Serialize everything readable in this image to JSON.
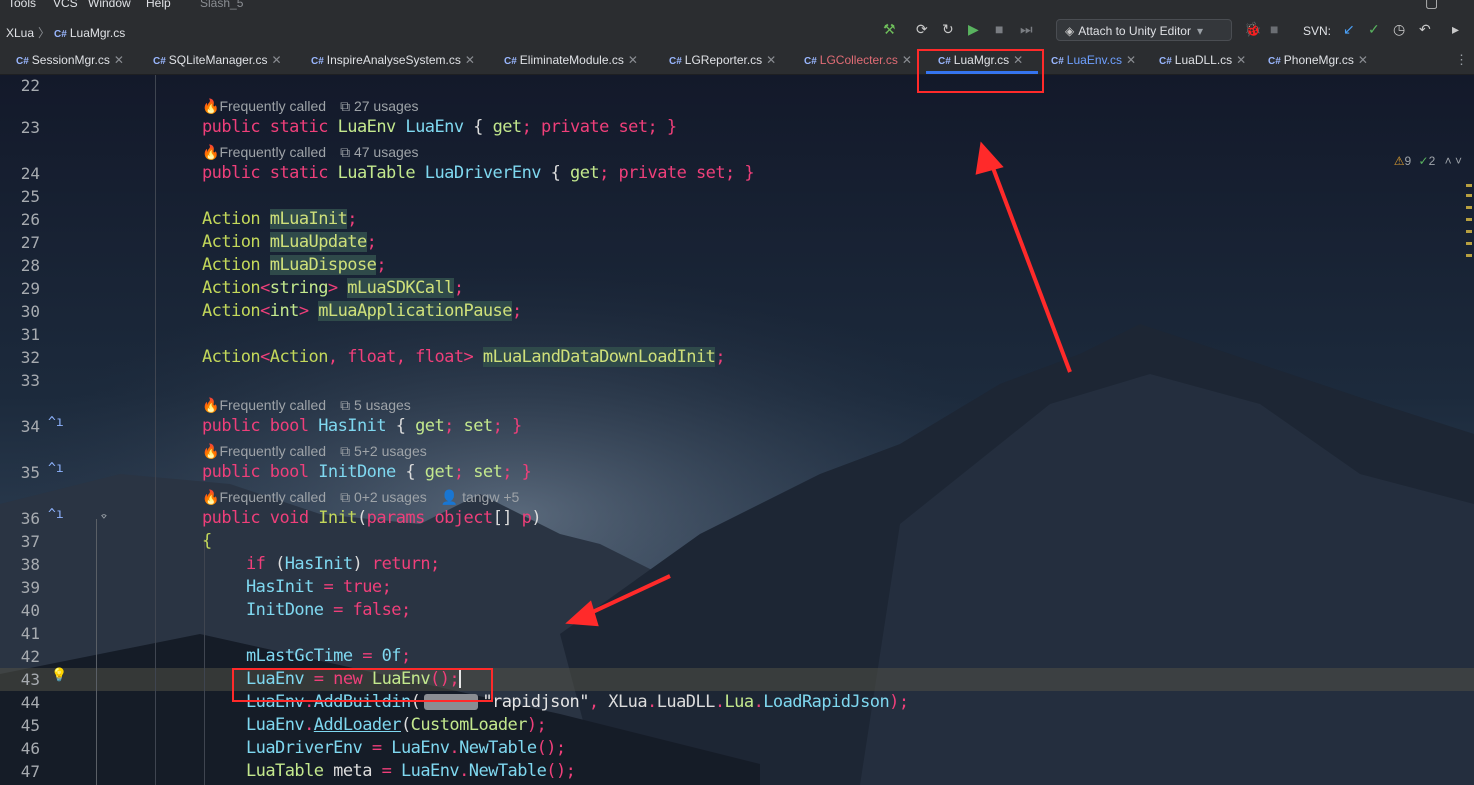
{
  "menu": {
    "items": [
      "Tools",
      "VCS",
      "Window",
      "Help"
    ],
    "project": "Slash_5"
  },
  "toolbar": {
    "breadcrumb_root": "XLua",
    "breadcrumb_file": "LuaMgr.cs",
    "attach_label": "Attach to Unity Editor",
    "svn_label": "SVN:"
  },
  "tabs": [
    {
      "name": "SessionMgr.cs"
    },
    {
      "name": "SQLiteManager.cs"
    },
    {
      "name": "InspireAnalyseSystem.cs"
    },
    {
      "name": "EliminateModule.cs"
    },
    {
      "name": "LGReporter.cs"
    },
    {
      "name": "LGCollecter.cs"
    },
    {
      "name": "LuaMgr.cs"
    },
    {
      "name": "LuaEnv.cs"
    },
    {
      "name": "LuaDLL.cs"
    },
    {
      "name": "PhoneMgr.cs"
    }
  ],
  "status": {
    "warnings": "9",
    "ok": "2"
  },
  "hints": {
    "h23": {
      "called": "Frequently called",
      "usages": "27 usages"
    },
    "h24": {
      "called": "Frequently called",
      "usages": "47 usages"
    },
    "h34": {
      "called": "Frequently called",
      "usages": "5 usages"
    },
    "h35": {
      "called": "Frequently called",
      "usages": "5+2 usages"
    },
    "h36": {
      "called": "Frequently called",
      "usages": "0+2 usages",
      "author": "tangw +5"
    }
  },
  "line_numbers": [
    "22",
    "23",
    "24",
    "25",
    "26",
    "27",
    "28",
    "29",
    "30",
    "31",
    "32",
    "33",
    "34",
    "35",
    "36",
    "37",
    "38",
    "39",
    "40",
    "41",
    "42",
    "43",
    "44",
    "45",
    "46",
    "47"
  ],
  "code": {
    "l23": {
      "a": "public static ",
      "b": "LuaEnv ",
      "c": "LuaEnv",
      "d": " { ",
      "e": "get",
      "f": "; ",
      "g": "private set",
      "h": "; }"
    },
    "l24": {
      "a": "public static ",
      "b": "LuaTable ",
      "c": "LuaDriverEnv",
      "d": " { ",
      "e": "get",
      "f": "; ",
      "g": "private set",
      "h": "; }"
    },
    "l26": {
      "a": "Action ",
      "b": "mLuaInit",
      "c": ";"
    },
    "l27": {
      "a": "Action ",
      "b": "mLuaUpdate",
      "c": ";"
    },
    "l28": {
      "a": "Action ",
      "b": "mLuaDispose",
      "c": ";"
    },
    "l29": {
      "a": "Action",
      "b": "<",
      "c": "string",
      "d": "> ",
      "e": "mLuaSDKCall",
      "f": ";"
    },
    "l30": {
      "a": "Action",
      "b": "<",
      "c": "int",
      "d": "> ",
      "e": "mLuaApplicationPause",
      "f": ";"
    },
    "l32": {
      "a": "Action",
      "b": "<",
      "c": "Action",
      "d": ", ",
      "e": "float",
      "f": ", ",
      "g": "float",
      "h": "> ",
      "i": "mLuaLandDataDownLoadInit",
      "j": ";"
    },
    "l34": {
      "a": "public bool ",
      "b": "HasInit",
      "c": " { ",
      "d": "get",
      "e": "; ",
      "f": "set",
      "g": "; }"
    },
    "l35": {
      "a": "public bool ",
      "b": "InitDone",
      "c": " { ",
      "d": "get",
      "e": "; ",
      "f": "set",
      "g": "; }"
    },
    "l36": {
      "a": "public void ",
      "b": "Init",
      "c": "(",
      "d": "params object",
      "e": "[] ",
      "f": "p",
      "g": ")"
    },
    "l37": {
      "a": "{"
    },
    "l38": {
      "a": "if ",
      "b": "(",
      "c": "HasInit",
      "d": ") ",
      "e": "return",
      "f": ";"
    },
    "l39": {
      "a": "HasInit",
      "b": " = ",
      "c": "true",
      "d": ";"
    },
    "l40": {
      "a": "InitDone",
      "b": " = ",
      "c": "false",
      "d": ";"
    },
    "l42": {
      "a": "mLastGcTime",
      "b": " = ",
      "c": "0f",
      "d": ";"
    },
    "l43": {
      "a": "LuaEnv",
      "b": " = ",
      "c": "new ",
      "d": "LuaEnv",
      "e": "();"
    },
    "l44": {
      "a": "LuaEnv",
      "b": ".",
      "c": "AddBuildin",
      "d": "(",
      "e": "\"rapidjson\"",
      "f": ", ",
      "g": "XLua",
      "h": ".",
      "i": "LuaDLL",
      "j": ".",
      "k": "Lua",
      "l": ".",
      "m": "LoadRapidJson",
      "n": ");"
    },
    "l45": {
      "a": "LuaEnv",
      "b": ".",
      "c": "AddLoader",
      "d": "(",
      "e": "CustomLoader",
      "f": ");"
    },
    "l46": {
      "a": "LuaDriverEnv",
      "b": " = ",
      "c": "LuaEnv",
      "d": ".",
      "e": "NewTable",
      "f": "();"
    },
    "l47": {
      "a": "LuaTable ",
      "b": "meta",
      "c": " = ",
      "d": "LuaEnv",
      "e": ".",
      "f": "NewTable",
      "g": "();"
    }
  },
  "colors": {
    "keyword": "#ef3f7a",
    "type": "#c3e88d",
    "identifier": "#7fd8f0",
    "annotation_box": "#ff2a2a",
    "active_tab_underline": "#3574f0"
  }
}
